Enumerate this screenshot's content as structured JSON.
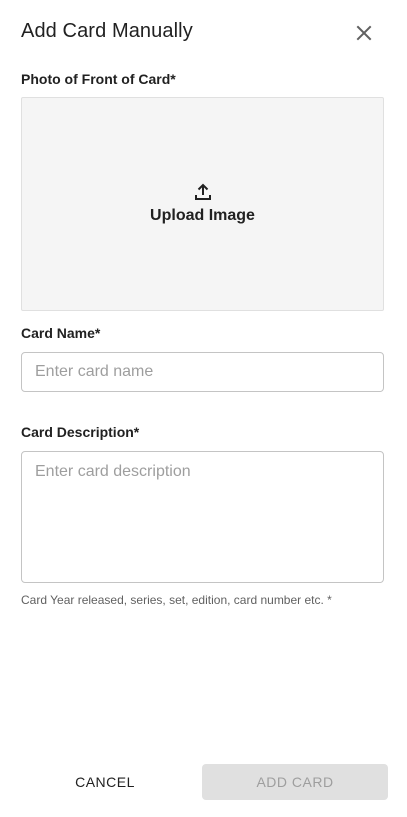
{
  "dialog": {
    "title": "Add Card Manually",
    "close_icon": "close-icon"
  },
  "photo": {
    "label": "Photo of Front of Card*",
    "upload_icon": "upload-icon",
    "upload_label": "Upload Image"
  },
  "card_name": {
    "label": "Card Name*",
    "value": "",
    "placeholder": "Enter card name"
  },
  "card_description": {
    "label": "Card Description*",
    "value": "",
    "placeholder": "Enter card description",
    "helper": "Card Year released, series, set, edition, card number etc. *"
  },
  "actions": {
    "cancel_label": "CANCEL",
    "add_label": "ADD CARD",
    "add_disabled": true
  },
  "colors": {
    "text": "#212121",
    "placeholder": "#9e9e9e",
    "upload_bg": "#f5f5f5",
    "disabled_bg": "#e0e0e0",
    "disabled_text": "#9e9e9e"
  }
}
